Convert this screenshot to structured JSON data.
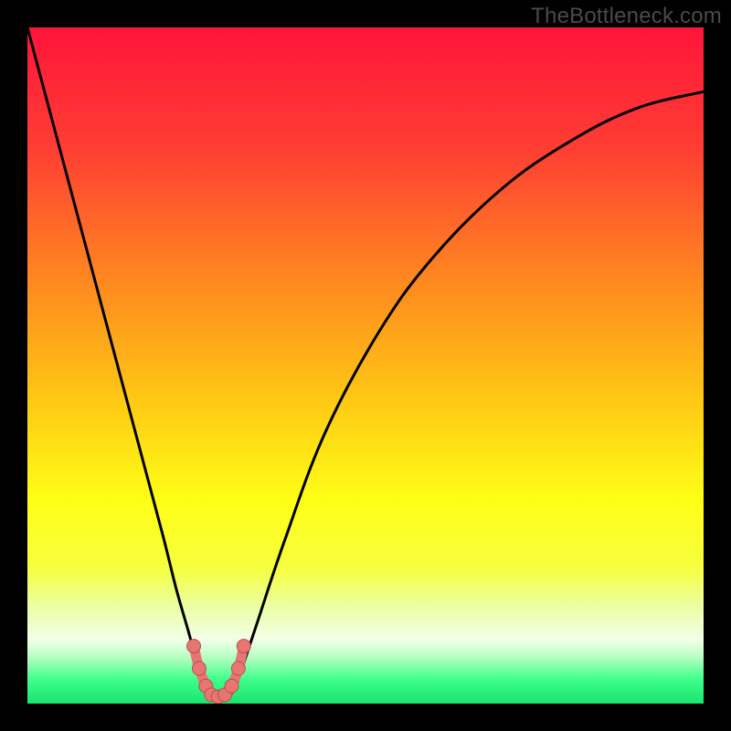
{
  "watermark": "TheBottleneck.com",
  "colors": {
    "gradient_stops": [
      {
        "offset": 0.0,
        "color": "#ff153a"
      },
      {
        "offset": 0.18,
        "color": "#ff3e33"
      },
      {
        "offset": 0.38,
        "color": "#ff8a1f"
      },
      {
        "offset": 0.55,
        "color": "#ffc814"
      },
      {
        "offset": 0.7,
        "color": "#ffff16"
      },
      {
        "offset": 0.8,
        "color": "#f6ff3f"
      },
      {
        "offset": 0.86,
        "color": "#eaffa9"
      },
      {
        "offset": 0.905,
        "color": "#f3ffe8"
      },
      {
        "offset": 0.93,
        "color": "#b9ffc4"
      },
      {
        "offset": 0.965,
        "color": "#3dff8a"
      },
      {
        "offset": 1.0,
        "color": "#19e36e"
      }
    ],
    "curve": "#000000",
    "marker_fill": "#e77572",
    "marker_stroke": "#b84f4d"
  },
  "chart_data": {
    "type": "line",
    "title": "",
    "xlabel": "",
    "ylabel": "",
    "xlim": [
      0,
      100
    ],
    "ylim": [
      0,
      100
    ],
    "grid": false,
    "series": [
      {
        "name": "bottleneck-curve",
        "x": [
          0,
          4,
          8,
          12,
          16,
          20,
          22,
          24,
          25,
          26,
          27,
          28,
          29,
          30,
          31,
          32,
          34,
          38,
          44,
          52,
          60,
          70,
          80,
          90,
          100
        ],
        "y": [
          100,
          85,
          70,
          55,
          40,
          25,
          17,
          10,
          6,
          3,
          1.2,
          0.5,
          0.5,
          1.2,
          3,
          6,
          12,
          24,
          40,
          55,
          66,
          76,
          83,
          88,
          90.5
        ]
      }
    ],
    "markers": {
      "name": "highlight-region",
      "x": [
        24.6,
        25.4,
        26.4,
        27.2,
        28.2,
        29.2,
        30.2,
        31.2,
        32.0
      ],
      "y": [
        8.5,
        5.2,
        2.6,
        1.3,
        1.0,
        1.3,
        2.6,
        5.2,
        8.5
      ]
    }
  }
}
